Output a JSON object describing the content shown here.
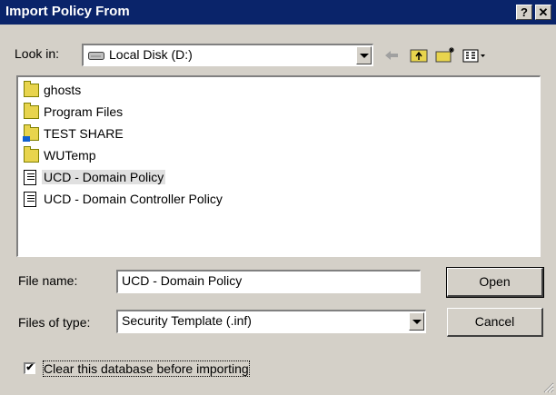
{
  "window": {
    "title": "Import Policy From",
    "help_glyph": "?",
    "close_glyph": "✕"
  },
  "lookin": {
    "label": "Look in:",
    "value": "Local Disk (D:)"
  },
  "toolbar": {
    "icons": [
      "back-arrow-icon",
      "up-folder-icon",
      "new-folder-icon",
      "view-menu-icon"
    ]
  },
  "files": [
    {
      "name": "ghosts",
      "icon": "folder-icon"
    },
    {
      "name": "Program Files",
      "icon": "folder-icon"
    },
    {
      "name": "TEST SHARE",
      "icon": "shared-folder-icon"
    },
    {
      "name": "WUTemp",
      "icon": "folder-icon"
    },
    {
      "name": "UCD - Domain  Policy",
      "icon": "template-file-icon",
      "selected": true
    },
    {
      "name": "UCD - Domain Controller Policy",
      "icon": "template-file-icon"
    }
  ],
  "filename": {
    "label": "File name:",
    "value": "UCD - Domain  Policy"
  },
  "filetype": {
    "label": "Files of type:",
    "value": "Security Template (.inf)"
  },
  "buttons": {
    "open": "Open",
    "cancel": "Cancel"
  },
  "clear_db": {
    "label": "Clear this database before importing",
    "checked": true,
    "check_glyph": "✔"
  }
}
